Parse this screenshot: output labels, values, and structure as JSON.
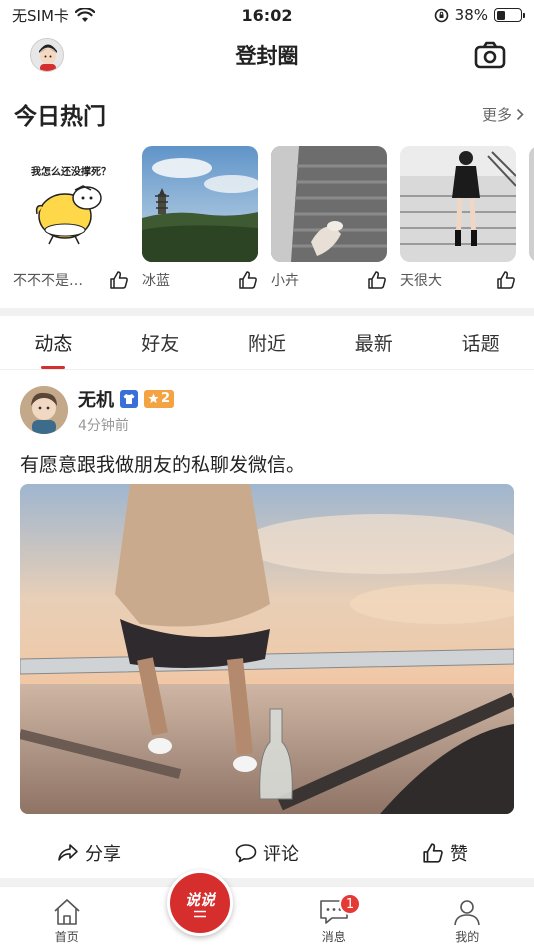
{
  "status_bar": {
    "carrier": "无SIM卡",
    "time": "16:02",
    "battery": "38%",
    "battery_level": 0.38
  },
  "nav": {
    "title": "登封圈"
  },
  "hot": {
    "title": "今日热门",
    "more_label": "更多",
    "items": [
      {
        "name": "不不不是…",
        "caption": "我怎么还没撑死？"
      },
      {
        "name": "冰蓝"
      },
      {
        "name": "小卉"
      },
      {
        "name": "天很大"
      }
    ]
  },
  "tabs": [
    {
      "label": "动态",
      "active": true
    },
    {
      "label": "好友"
    },
    {
      "label": "附近"
    },
    {
      "label": "最新"
    },
    {
      "label": "话题"
    }
  ],
  "post": {
    "user": "无机",
    "level": "2",
    "time": "4分钟前",
    "text": "有愿意跟我做朋友的私聊发微信。",
    "actions": {
      "share": "分享",
      "comment": "评论",
      "like": "赞"
    }
  },
  "tabbar": {
    "home": "首页",
    "post_button": "说说",
    "messages": "消息",
    "messages_badge": "1",
    "me": "我的"
  },
  "colors": {
    "accent": "#d62d2d",
    "badge_blue": "#3b6fd8",
    "badge_orange": "#f3a341"
  }
}
